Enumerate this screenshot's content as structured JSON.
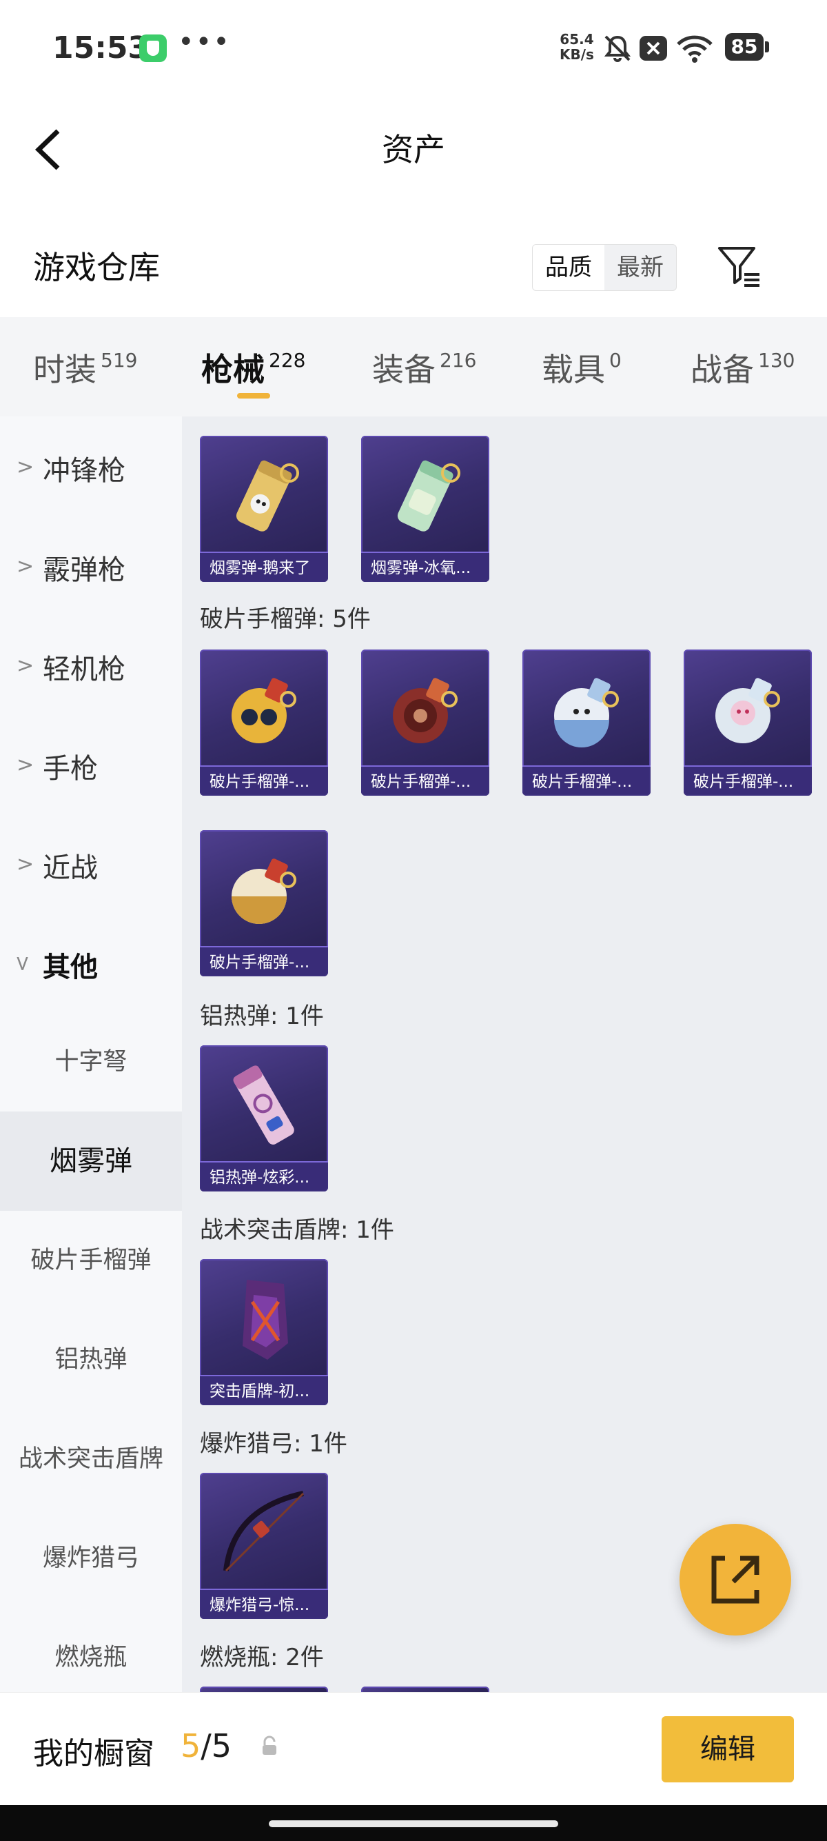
{
  "status_bar": {
    "time": "15:53",
    "net_speed": "65.4",
    "net_unit": "KB/s",
    "battery": "85",
    "icons": [
      "shield-icon",
      "more-icon",
      "mute-icon",
      "close-box-icon",
      "wifi-icon",
      "battery-icon"
    ]
  },
  "header": {
    "title": "资产",
    "back_icon": "chevron-left-icon"
  },
  "repo": {
    "title": "游戏仓库",
    "sort_options": [
      "品质",
      "最新"
    ],
    "active_sort": "品质",
    "filter_icon": "filter-icon"
  },
  "tabs": [
    {
      "label": "时装",
      "count": "519"
    },
    {
      "label": "枪械",
      "count": "228"
    },
    {
      "label": "装备",
      "count": "216"
    },
    {
      "label": "载具",
      "count": "0"
    },
    {
      "label": "战备",
      "count": "130"
    }
  ],
  "active_tab": "枪械",
  "sidebar": {
    "categories": [
      "冲锋枪",
      "霰弹枪",
      "轻机枪",
      "手枪",
      "近战",
      "其他"
    ],
    "subitems": [
      "十字弩",
      "烟雾弹",
      "破片手榴弹",
      "铝热弹",
      "战术突击盾牌",
      "爆炸猎弓",
      "燃烧瓶"
    ],
    "active_subitem": "烟雾弹"
  },
  "content": {
    "smoke_items": [
      "烟雾弹-鹅来了",
      "烟雾弹-冰氧..."
    ],
    "frag": {
      "label": "破片手榴弹: 5件",
      "items": [
        "破片手榴弹-...",
        "破片手榴弹-...",
        "破片手榴弹-...",
        "破片手榴弹-...",
        "破片手榴弹-..."
      ]
    },
    "thermite": {
      "label": "铝热弹: 1件",
      "items": [
        "铝热弹-炫彩..."
      ]
    },
    "shield": {
      "label": "战术突击盾牌: 1件",
      "items": [
        "突击盾牌-初..."
      ]
    },
    "bow": {
      "label": "爆炸猎弓: 1件",
      "items": [
        "爆炸猎弓-惊..."
      ]
    },
    "molotov": {
      "label": "燃烧瓶: 2件"
    }
  },
  "share_icon": "share-icon",
  "bottom": {
    "window_label": "我的橱窗",
    "count_current": "5",
    "count_sep": "/",
    "count_total": "5",
    "lock_icon": "lock-icon",
    "edit_label": "编辑"
  },
  "colors": {
    "accent": "#f2bd3b",
    "card_bg": "#372d6c",
    "sidebar_bg": "#f7f8fa"
  }
}
